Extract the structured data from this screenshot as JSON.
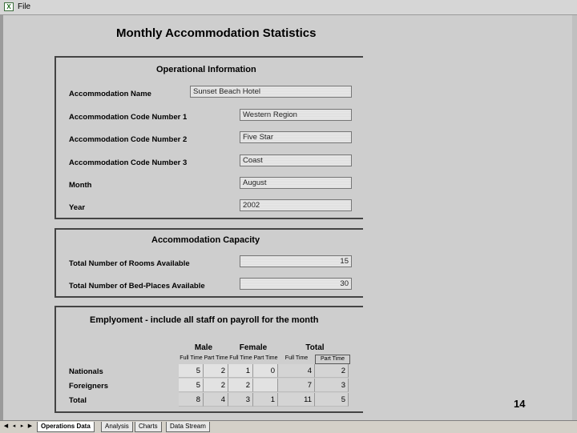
{
  "window": {
    "menu_file": "File"
  },
  "page_title": "Monthly Accommodation Statistics",
  "operational": {
    "title": "Operational Information",
    "rows": [
      {
        "label": "Accommodation Name",
        "value": "Sunset Beach Hotel"
      },
      {
        "label": "Accommodation Code Number 1",
        "value": "Western Region"
      },
      {
        "label": "Accommodation Code Number 2",
        "value": "Five Star"
      },
      {
        "label": "Accommodation Code Number 3",
        "value": "Coast"
      },
      {
        "label": "Month",
        "value": "August"
      },
      {
        "label": "Year",
        "value": "2002"
      }
    ]
  },
  "capacity": {
    "title": "Accommodation Capacity",
    "rows": [
      {
        "label": "Total Number of Rooms Available",
        "value": "15"
      },
      {
        "label": "Total Number of Bed-Places Available",
        "value": "30"
      }
    ]
  },
  "employment": {
    "title": "Emplyoment - include all staff on payroll for the month",
    "groups": [
      "Male",
      "Female",
      "Total"
    ],
    "subheaders": [
      "Full Time",
      "Part Time",
      "Full Time",
      "Part Time",
      "Full Time",
      "Part Time"
    ],
    "rows": [
      {
        "label": "Nationals",
        "values": [
          "5",
          "2",
          "1",
          "0",
          "4",
          "2"
        ]
      },
      {
        "label": "Foreigners",
        "values": [
          "5",
          "2",
          "2",
          "",
          "7",
          "3"
        ]
      },
      {
        "label": "Total",
        "values": [
          "8",
          "4",
          "3",
          "1",
          "11",
          "5"
        ]
      }
    ]
  },
  "page_number": "14",
  "sheet_tabs": [
    "Operations Data",
    "Analysis",
    "Charts",
    "Data Stream"
  ],
  "colors": {
    "sheet_bg": "#cecece",
    "field_bg": "#e8e8e8"
  }
}
